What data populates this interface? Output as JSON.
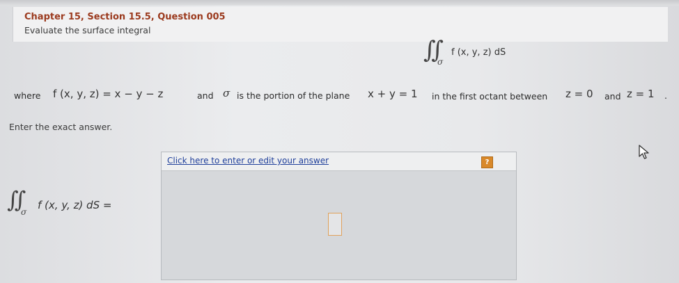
{
  "header": {
    "chapter_title": "Chapter 15, Section 15.5, Question 005",
    "instruction": "Evaluate the surface integral"
  },
  "display_integral": {
    "sign": "∬",
    "subscript": "σ",
    "integrand": "f (x, y, z) dS"
  },
  "problem": {
    "where": "where",
    "function_def": "f (x, y, z) = x − y − z",
    "and1": "and",
    "sigma": "σ",
    "portion_text": "is the portion of the plane",
    "plane": "x + y = 1",
    "octant_text": "in the first octant between",
    "z0": "z = 0",
    "and2": "and",
    "z1": "z = 1",
    "period": "."
  },
  "enter_exact": "Enter the exact answer.",
  "answer": {
    "link_label": "Click here to enter or edit your answer",
    "help_label": "?",
    "lhs_sign": "∬",
    "lhs_subscript": "σ",
    "lhs_expression": "f (x, y, z) dS ="
  },
  "icons": {
    "help": "help-icon",
    "cursor": "mouse-pointer-icon"
  },
  "colors": {
    "chapter_title": "#9b3a1e",
    "link": "#1f3f9a",
    "help_button": "#d9892a",
    "answer_slot_border": "#e0a15a"
  }
}
